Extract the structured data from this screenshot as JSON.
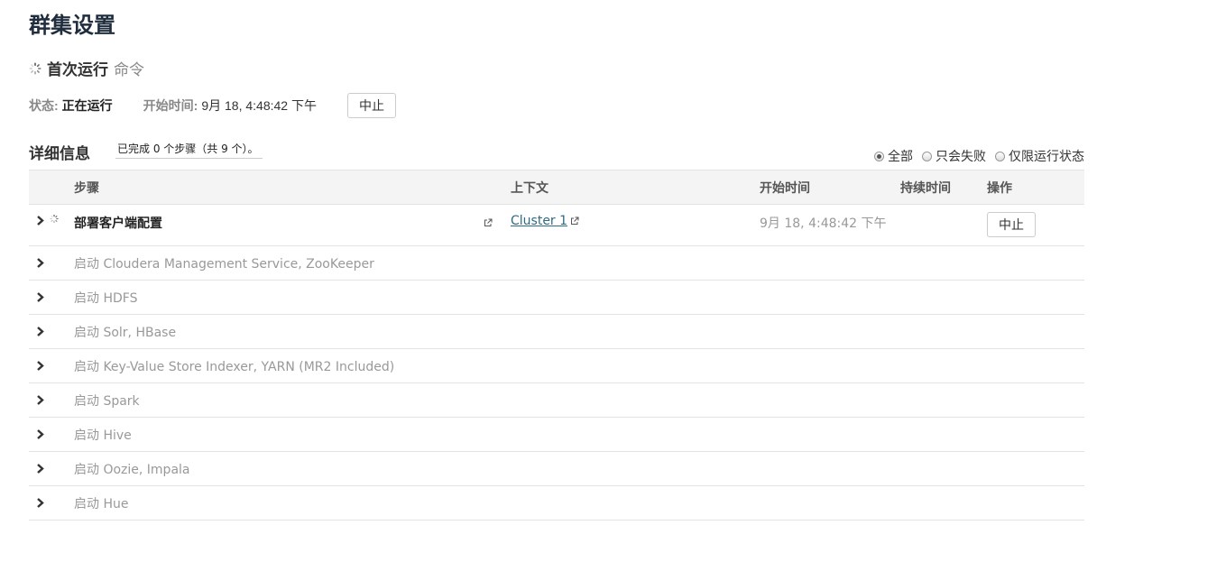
{
  "page": {
    "title": "群集设置"
  },
  "command": {
    "name": "首次运行",
    "suffix": "命令"
  },
  "status": {
    "state_label": "状态:",
    "state_value": "正在运行",
    "start_label": "开始时间:",
    "start_value": "9月 18, 4:48:42 下午",
    "abort_label": "中止"
  },
  "details": {
    "title": "详细信息",
    "progress_text": "已完成 0 个步骤（共 9 个）。",
    "filters": [
      {
        "label": "全部",
        "checked": true
      },
      {
        "label": "只会失败",
        "checked": false
      },
      {
        "label": "仅限运行状态",
        "checked": false
      }
    ]
  },
  "table": {
    "headers": {
      "step": "步骤",
      "context": "上下文",
      "start_time": "开始时间",
      "duration": "持续时间",
      "action": "操作"
    },
    "rows": [
      {
        "step": "部署客户端配置",
        "context": "Cluster 1",
        "start_time": "9月 18, 4:48:42 下午",
        "duration": "",
        "action": "中止",
        "running": true
      },
      {
        "step": "启动 Cloudera Management Service, ZooKeeper"
      },
      {
        "step": "启动 HDFS"
      },
      {
        "step": "启动 Solr, HBase"
      },
      {
        "step": "启动 Key-Value Store Indexer, YARN (MR2 Included)"
      },
      {
        "step": "启动 Spark"
      },
      {
        "step": "启动 Hive"
      },
      {
        "step": "启动 Oozie, Impala"
      },
      {
        "step": "启动 Hue"
      }
    ]
  },
  "icons": {
    "spinner": "spinner-icon",
    "chevron": "chevron-right-icon",
    "external": "external-link-icon"
  }
}
